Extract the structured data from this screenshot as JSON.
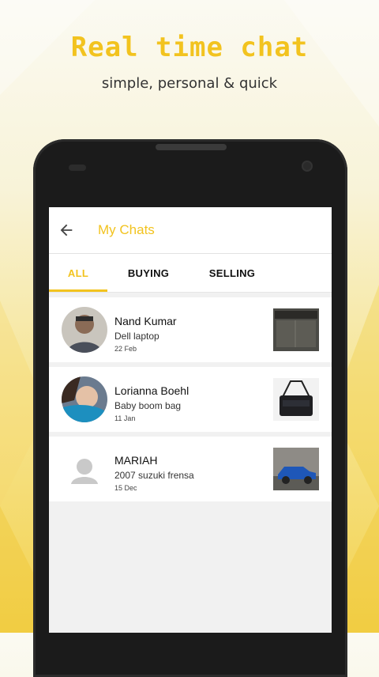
{
  "promo": {
    "headline": "Real time chat",
    "subheadline": "simple, personal & quick"
  },
  "app": {
    "title": "My Chats",
    "tabs": [
      {
        "label": "ALL",
        "active": true
      },
      {
        "label": "BUYING",
        "active": false
      },
      {
        "label": "SELLING",
        "active": false
      }
    ],
    "chats": [
      {
        "name": "Nand Kumar",
        "item": "Dell laptop",
        "date": "22 Feb",
        "avatar_icon": "person-photo",
        "thumb_icon": "laptop-photo"
      },
      {
        "name": "Lorianna Boehl",
        "item": "Baby boom bag",
        "date": "11 Jan",
        "avatar_icon": "baby-photo",
        "thumb_icon": "bag-photo"
      },
      {
        "name": "MARIAH",
        "item": "2007 suzuki frensa",
        "date": "15 Dec",
        "avatar_icon": "default-user-icon",
        "thumb_icon": "car-photo"
      }
    ]
  },
  "colors": {
    "accent": "#f2c31f",
    "background_light": "#fbfaf2",
    "background_yellow": "#f3d24f"
  }
}
